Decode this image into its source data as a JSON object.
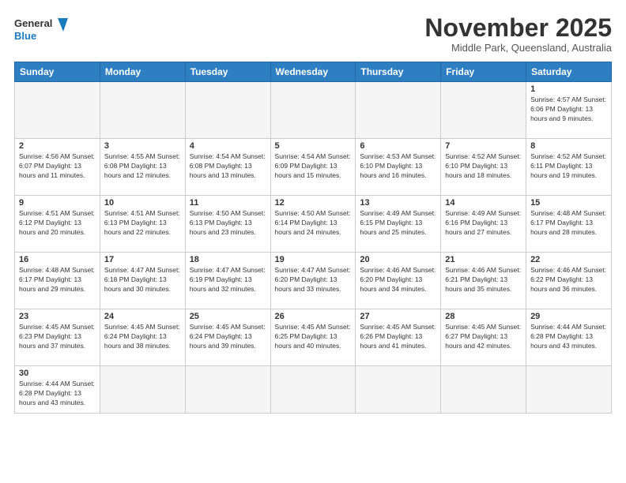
{
  "header": {
    "logo_general": "General",
    "logo_blue": "Blue",
    "month_title": "November 2025",
    "location": "Middle Park, Queensland, Australia"
  },
  "days_of_week": [
    "Sunday",
    "Monday",
    "Tuesday",
    "Wednesday",
    "Thursday",
    "Friday",
    "Saturday"
  ],
  "weeks": [
    [
      {
        "day": "",
        "info": ""
      },
      {
        "day": "",
        "info": ""
      },
      {
        "day": "",
        "info": ""
      },
      {
        "day": "",
        "info": ""
      },
      {
        "day": "",
        "info": ""
      },
      {
        "day": "",
        "info": ""
      },
      {
        "day": "1",
        "info": "Sunrise: 4:57 AM\nSunset: 6:06 PM\nDaylight: 13 hours and 9 minutes."
      }
    ],
    [
      {
        "day": "2",
        "info": "Sunrise: 4:56 AM\nSunset: 6:07 PM\nDaylight: 13 hours and 11 minutes."
      },
      {
        "day": "3",
        "info": "Sunrise: 4:55 AM\nSunset: 6:08 PM\nDaylight: 13 hours and 12 minutes."
      },
      {
        "day": "4",
        "info": "Sunrise: 4:54 AM\nSunset: 6:08 PM\nDaylight: 13 hours and 13 minutes."
      },
      {
        "day": "5",
        "info": "Sunrise: 4:54 AM\nSunset: 6:09 PM\nDaylight: 13 hours and 15 minutes."
      },
      {
        "day": "6",
        "info": "Sunrise: 4:53 AM\nSunset: 6:10 PM\nDaylight: 13 hours and 16 minutes."
      },
      {
        "day": "7",
        "info": "Sunrise: 4:52 AM\nSunset: 6:10 PM\nDaylight: 13 hours and 18 minutes."
      },
      {
        "day": "8",
        "info": "Sunrise: 4:52 AM\nSunset: 6:11 PM\nDaylight: 13 hours and 19 minutes."
      }
    ],
    [
      {
        "day": "9",
        "info": "Sunrise: 4:51 AM\nSunset: 6:12 PM\nDaylight: 13 hours and 20 minutes."
      },
      {
        "day": "10",
        "info": "Sunrise: 4:51 AM\nSunset: 6:13 PM\nDaylight: 13 hours and 22 minutes."
      },
      {
        "day": "11",
        "info": "Sunrise: 4:50 AM\nSunset: 6:13 PM\nDaylight: 13 hours and 23 minutes."
      },
      {
        "day": "12",
        "info": "Sunrise: 4:50 AM\nSunset: 6:14 PM\nDaylight: 13 hours and 24 minutes."
      },
      {
        "day": "13",
        "info": "Sunrise: 4:49 AM\nSunset: 6:15 PM\nDaylight: 13 hours and 25 minutes."
      },
      {
        "day": "14",
        "info": "Sunrise: 4:49 AM\nSunset: 6:16 PM\nDaylight: 13 hours and 27 minutes."
      },
      {
        "day": "15",
        "info": "Sunrise: 4:48 AM\nSunset: 6:17 PM\nDaylight: 13 hours and 28 minutes."
      }
    ],
    [
      {
        "day": "16",
        "info": "Sunrise: 4:48 AM\nSunset: 6:17 PM\nDaylight: 13 hours and 29 minutes."
      },
      {
        "day": "17",
        "info": "Sunrise: 4:47 AM\nSunset: 6:18 PM\nDaylight: 13 hours and 30 minutes."
      },
      {
        "day": "18",
        "info": "Sunrise: 4:47 AM\nSunset: 6:19 PM\nDaylight: 13 hours and 32 minutes."
      },
      {
        "day": "19",
        "info": "Sunrise: 4:47 AM\nSunset: 6:20 PM\nDaylight: 13 hours and 33 minutes."
      },
      {
        "day": "20",
        "info": "Sunrise: 4:46 AM\nSunset: 6:20 PM\nDaylight: 13 hours and 34 minutes."
      },
      {
        "day": "21",
        "info": "Sunrise: 4:46 AM\nSunset: 6:21 PM\nDaylight: 13 hours and 35 minutes."
      },
      {
        "day": "22",
        "info": "Sunrise: 4:46 AM\nSunset: 6:22 PM\nDaylight: 13 hours and 36 minutes."
      }
    ],
    [
      {
        "day": "23",
        "info": "Sunrise: 4:45 AM\nSunset: 6:23 PM\nDaylight: 13 hours and 37 minutes."
      },
      {
        "day": "24",
        "info": "Sunrise: 4:45 AM\nSunset: 6:24 PM\nDaylight: 13 hours and 38 minutes."
      },
      {
        "day": "25",
        "info": "Sunrise: 4:45 AM\nSunset: 6:24 PM\nDaylight: 13 hours and 39 minutes."
      },
      {
        "day": "26",
        "info": "Sunrise: 4:45 AM\nSunset: 6:25 PM\nDaylight: 13 hours and 40 minutes."
      },
      {
        "day": "27",
        "info": "Sunrise: 4:45 AM\nSunset: 6:26 PM\nDaylight: 13 hours and 41 minutes."
      },
      {
        "day": "28",
        "info": "Sunrise: 4:45 AM\nSunset: 6:27 PM\nDaylight: 13 hours and 42 minutes."
      },
      {
        "day": "29",
        "info": "Sunrise: 4:44 AM\nSunset: 6:28 PM\nDaylight: 13 hours and 43 minutes."
      }
    ],
    [
      {
        "day": "30",
        "info": "Sunrise: 4:44 AM\nSunset: 6:28 PM\nDaylight: 13 hours and 43 minutes."
      },
      {
        "day": "",
        "info": ""
      },
      {
        "day": "",
        "info": ""
      },
      {
        "day": "",
        "info": ""
      },
      {
        "day": "",
        "info": ""
      },
      {
        "day": "",
        "info": ""
      },
      {
        "day": "",
        "info": ""
      }
    ]
  ]
}
